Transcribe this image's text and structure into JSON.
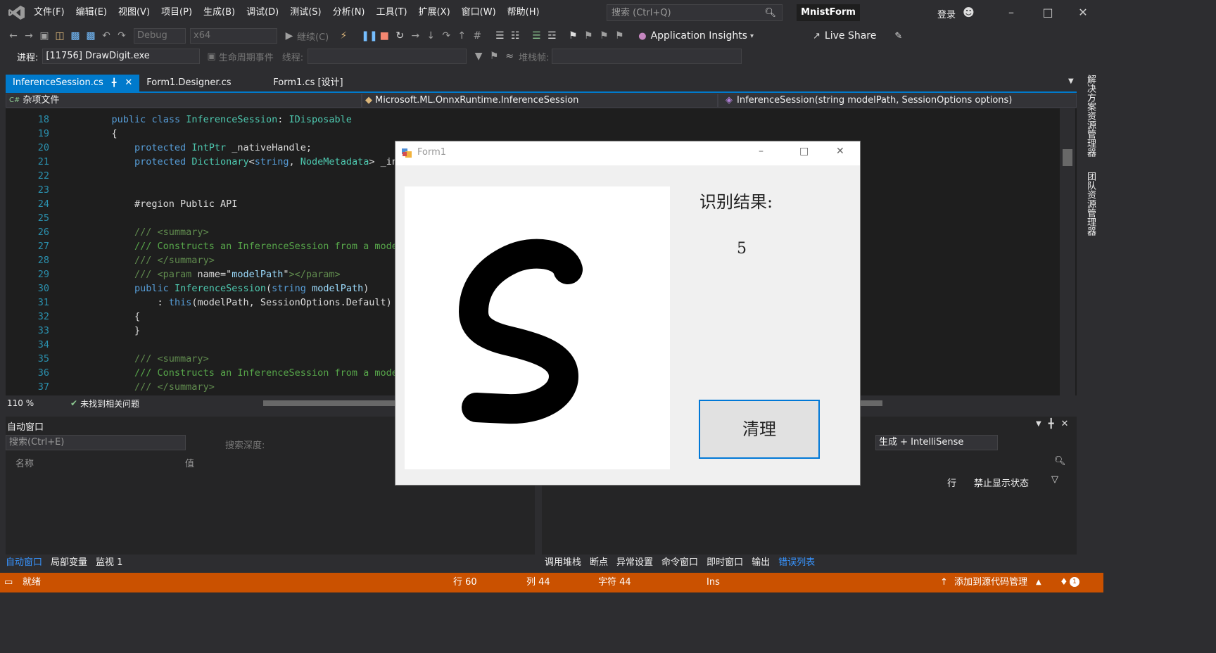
{
  "menu": [
    "文件(F)",
    "编辑(E)",
    "视图(V)",
    "项目(P)",
    "生成(B)",
    "调试(D)",
    "测试(S)",
    "分析(N)",
    "工具(T)",
    "扩展(X)",
    "窗口(W)",
    "帮助(H)"
  ],
  "search": {
    "placeholder": "搜索 (Ctrl+Q)"
  },
  "project_name": "MnistForm",
  "login": "登录",
  "toolbar": {
    "config": "Debug",
    "platform": "x64",
    "continue": "继续(C)",
    "app_insights": "Application Insights",
    "live_share": "Live Share"
  },
  "debug_toolbar": {
    "process_label": "进程:",
    "process_value": "[11756] DrawDigit.exe",
    "lifecycle": "生命周期事件",
    "thread_label": "线程:",
    "stackframe_label": "堆栈帧:"
  },
  "tabs": [
    {
      "label": "InferenceSession.cs",
      "active": true
    },
    {
      "label": "Form1.Designer.cs",
      "active": false
    },
    {
      "label": "Form1.cs [设计]",
      "active": false
    }
  ],
  "navbar": {
    "project": "杂项文件",
    "type": "Microsoft.ML.OnnxRuntime.InferenceSession",
    "member": "InferenceSession(string modelPath, SessionOptions options)"
  },
  "code_lines": [
    {
      "n": "18",
      "html": "    <span class='kw'>public</span> <span class='kw'>class</span> <span class='ty'>InferenceSession</span><span class='pl'>: </span><span class='ty'>IDisposable</span>"
    },
    {
      "n": "19",
      "html": "    <span class='pl'>{</span>"
    },
    {
      "n": "20",
      "html": "        <span class='kw'>protected</span> <span class='ty'>IntPtr</span> <span class='pl'>_nativeHandle;</span>"
    },
    {
      "n": "21",
      "html": "        <span class='kw'>protected</span> <span class='ty'>Dictionary</span><span class='pl'>&lt;</span><span class='kw'>string</span><span class='pl'>, </span><span class='ty'>NodeMetadata</span><span class='pl'>&gt; _inp</span>"
    },
    {
      "n": "22",
      "html": ""
    },
    {
      "n": "23",
      "html": ""
    },
    {
      "n": "24",
      "html": "        <span class='pl'>#region Public API</span>"
    },
    {
      "n": "25",
      "html": ""
    },
    {
      "n": "26",
      "html": "        <span class='xml'>/// &lt;summary&gt;</span>"
    },
    {
      "n": "27",
      "html": "        <span class='cm'>/// Constructs an InferenceSession from a model</span>"
    },
    {
      "n": "28",
      "html": "        <span class='xml'>/// &lt;/summary&gt;</span>"
    },
    {
      "n": "29",
      "html": "        <span class='xml'>/// &lt;param </span><span class='pl'>name=</span><span class='pl'>\"</span><span class='pa'>modelPath</span><span class='pl'>\"</span><span class='xml'>&gt;&lt;/param&gt;</span>"
    },
    {
      "n": "30",
      "html": "        <span class='kw'>public</span> <span class='ty'>InferenceSession</span><span class='pl'>(</span><span class='kw'>string</span> <span class='pa'>modelPath</span><span class='pl'>)</span>"
    },
    {
      "n": "31",
      "html": "            <span class='pl'>: </span><span class='kw'>this</span><span class='pl'>(modelPath, SessionOptions.Default)</span>"
    },
    {
      "n": "32",
      "html": "        <span class='pl'>{</span>"
    },
    {
      "n": "33",
      "html": "        <span class='pl'>}</span>"
    },
    {
      "n": "34",
      "html": ""
    },
    {
      "n": "35",
      "html": "        <span class='xml'>/// &lt;summary&gt;</span>"
    },
    {
      "n": "36",
      "html": "        <span class='cm'>/// Constructs an InferenceSession from a model</span>"
    },
    {
      "n": "37",
      "html": "        <span class='xml'>/// &lt;/summary&gt;</span>"
    }
  ],
  "editor_status": {
    "zoom": "110 %",
    "issues": "未找到相关问题"
  },
  "auto_window": {
    "title": "自动窗口",
    "search_placeholder": "搜索(Ctrl+E)",
    "search_depth": "搜索深度:",
    "col_name": "名称",
    "col_value": "值",
    "tabs": [
      "自动窗口",
      "局部变量",
      "监视 1"
    ]
  },
  "error_list": {
    "build_filter": "生成 + IntelliSense",
    "col_line": "行",
    "col_suppress": "禁止显示状态",
    "tabs": [
      "调用堆栈",
      "断点",
      "异常设置",
      "命令窗口",
      "即时窗口",
      "输出",
      "错误列表"
    ]
  },
  "side_strip": [
    "解决方案资源管理器",
    "团队资源管理器"
  ],
  "statusbar": {
    "ready": "就绪",
    "line": "行 60",
    "col": "列 44",
    "char": "字符 44",
    "ins": "Ins",
    "source_control": "添加到源代码管理",
    "notifications": "1"
  },
  "form1": {
    "title": "Form1",
    "result_label": "识别结果:",
    "result_value": "5",
    "clear_button": "清理"
  }
}
